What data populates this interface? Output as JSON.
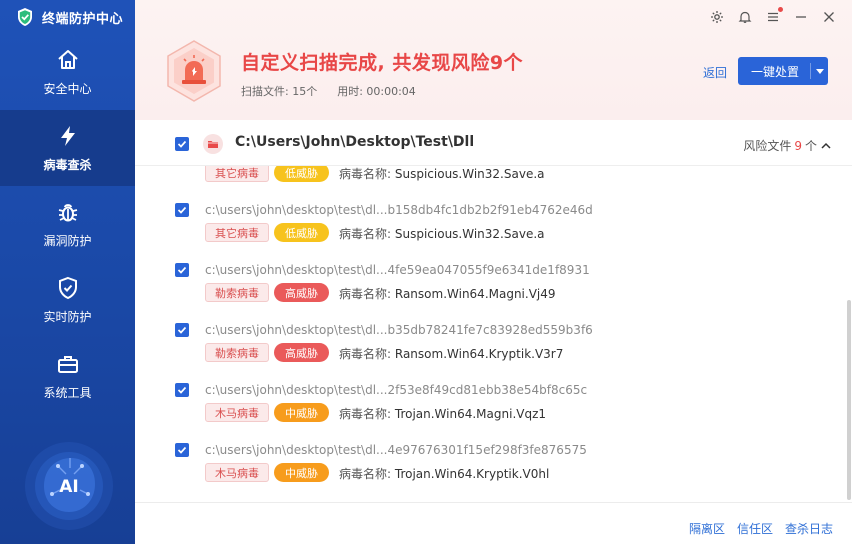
{
  "app": {
    "title": "终端防护中心"
  },
  "sidebar": {
    "items": [
      {
        "label": "安全中心",
        "icon": "home-icon",
        "active": false
      },
      {
        "label": "病毒查杀",
        "icon": "lightning-icon",
        "active": true
      },
      {
        "label": "漏洞防护",
        "icon": "bug-icon",
        "active": false
      },
      {
        "label": "实时防护",
        "icon": "shield-check-icon",
        "active": false
      },
      {
        "label": "系统工具",
        "icon": "toolbox-icon",
        "active": false
      }
    ],
    "ai_label": "AI"
  },
  "header": {
    "title": "自定义扫描完成, 共发现风险9个",
    "scanned": "扫描文件: 15个",
    "elapsed": "用时: 00:00:04",
    "back": "返回",
    "action": "一键处置",
    "accent": "#e84747"
  },
  "group": {
    "path": "C:\\Users\\John\\Desktop\\Test\\Dll",
    "risk_label": "风险文件",
    "risk_count": "9",
    "risk_unit": "个"
  },
  "rows": [
    {
      "path": "",
      "type": "其它病毒",
      "level": "低威胁",
      "level_class": "lvl-low",
      "virus_key": "病毒名称:",
      "virus": "Suspicious.Win32.Save.a"
    },
    {
      "path": "c:\\users\\john\\desktop\\test\\dl...b158db4fc1db2b2f91eb4762e46d",
      "type": "其它病毒",
      "level": "低威胁",
      "level_class": "lvl-low",
      "virus_key": "病毒名称:",
      "virus": "Suspicious.Win32.Save.a"
    },
    {
      "path": "c:\\users\\john\\desktop\\test\\dl...4fe59ea047055f9e6341de1f8931",
      "type": "勒索病毒",
      "level": "高威胁",
      "level_class": "lvl-high",
      "virus_key": "病毒名称:",
      "virus": "Ransom.Win64.Magni.Vj49"
    },
    {
      "path": "c:\\users\\john\\desktop\\test\\dl...b35db78241fe7c83928ed559b3f6",
      "type": "勒索病毒",
      "level": "高威胁",
      "level_class": "lvl-high",
      "virus_key": "病毒名称:",
      "virus": "Ransom.Win64.Kryptik.V3r7"
    },
    {
      "path": "c:\\users\\john\\desktop\\test\\dl...2f53e8f49cd81ebb38e54bf8c65c",
      "type": "木马病毒",
      "level": "中威胁",
      "level_class": "lvl-mid",
      "virus_key": "病毒名称:",
      "virus": "Trojan.Win64.Magni.Vqz1"
    },
    {
      "path": "c:\\users\\john\\desktop\\test\\dl...4e97676301f15ef298f3fe876575",
      "type": "木马病毒",
      "level": "中威胁",
      "level_class": "lvl-mid",
      "virus_key": "病毒名称:",
      "virus": "Trojan.Win64.Kryptik.V0hl"
    }
  ],
  "footer": {
    "links": [
      "隔离区",
      "信任区",
      "查杀日志"
    ]
  }
}
